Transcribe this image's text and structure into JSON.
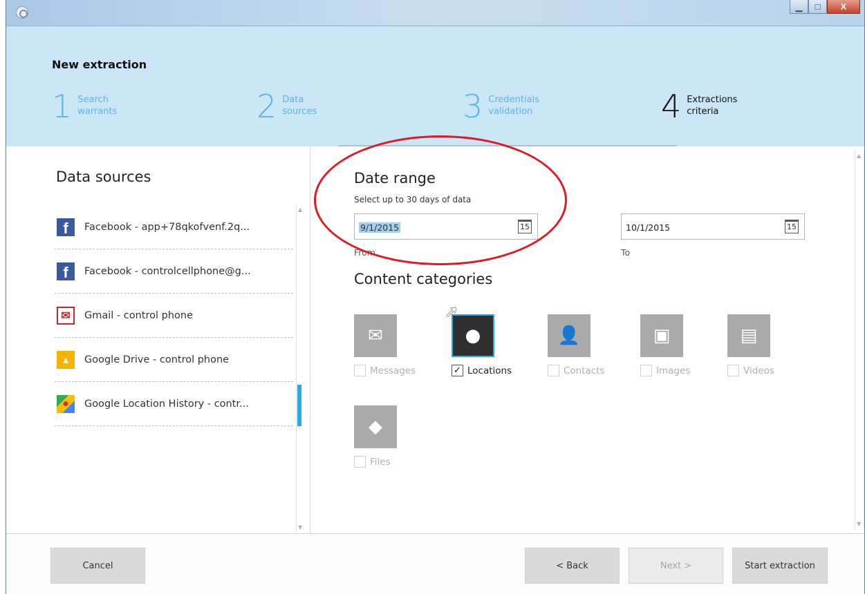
{
  "window": {
    "close_label": "X"
  },
  "header": {
    "title": "New extraction",
    "steps": [
      {
        "num": "1",
        "line1": "Search",
        "line2": "warrants"
      },
      {
        "num": "2",
        "line1": "Data",
        "line2": "sources"
      },
      {
        "num": "3",
        "line1": "Credentials",
        "line2": "validation"
      },
      {
        "num": "4",
        "line1": "Extractions",
        "line2": "criteria"
      }
    ],
    "active_step": 4
  },
  "sidebar": {
    "title": "Data sources",
    "items": [
      {
        "icon": "facebook-icon",
        "glyph": "f",
        "label": "Facebook - app+78qkofvenf.2q..."
      },
      {
        "icon": "facebook-icon",
        "glyph": "f",
        "label": "Facebook - controlcellphone@g..."
      },
      {
        "icon": "gmail-icon",
        "glyph": "✉",
        "label": "Gmail - control phone"
      },
      {
        "icon": "google-drive-icon",
        "glyph": "▲",
        "label": "Google Drive - control phone"
      },
      {
        "icon": "google-maps-icon",
        "glyph": "●",
        "label": "Google Location History - contr..."
      }
    ],
    "selected_index": 4
  },
  "date_range": {
    "title": "Date range",
    "subtitle": "Select up to 30 days of data",
    "from_value": "9/1/2015",
    "from_caption": "From",
    "to_value": "10/1/2015",
    "to_caption": "To",
    "calendar_glyph": "15"
  },
  "content_categories": {
    "title": "Content categories",
    "items": [
      {
        "label": "Messages",
        "icon": "envelope-icon",
        "glyph": "✉",
        "checked": false
      },
      {
        "label": "Locations",
        "icon": "location-pin-icon",
        "glyph": "●",
        "checked": true
      },
      {
        "label": "Contacts",
        "icon": "person-icon",
        "glyph": "👤",
        "checked": false
      },
      {
        "label": "Images",
        "icon": "image-icon",
        "glyph": "▣",
        "checked": false
      },
      {
        "label": "Videos",
        "icon": "film-icon",
        "glyph": "▤",
        "checked": false
      },
      {
        "label": "Files",
        "icon": "tag-icon",
        "glyph": "◆",
        "checked": false
      }
    ],
    "check_glyph": "✓"
  },
  "footer": {
    "cancel_label": "Cancel",
    "back_label": "< Back",
    "next_label": "Next >",
    "start_label": "Start extraction"
  },
  "colors": {
    "accent": "#29a9e6",
    "header_bg": "#cbe6f6",
    "annotation": "#e01a22"
  }
}
